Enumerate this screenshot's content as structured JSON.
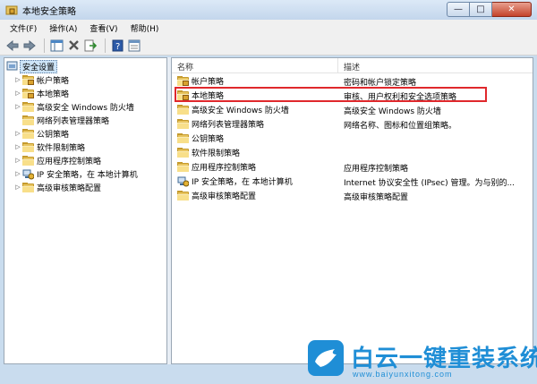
{
  "window": {
    "title": "本地安全策略",
    "controls": {
      "minimize": "—",
      "maximize": "□",
      "close": "✕"
    }
  },
  "menu": [
    "文件(F)",
    "操作(A)",
    "查看(V)",
    "帮助(H)"
  ],
  "toolbar_icons": [
    "back-icon",
    "forward-icon",
    "show-hide-tree-icon",
    "delete-icon",
    "export-list-icon",
    "help-icon",
    "properties-icon"
  ],
  "tree": {
    "root": "安全设置",
    "items": [
      {
        "label": "帐户策略",
        "icon": "lock-folder-icon"
      },
      {
        "label": "本地策略",
        "icon": "lock-folder-icon"
      },
      {
        "label": "高级安全 Windows 防火墙",
        "icon": "folder-icon"
      },
      {
        "label": "网络列表管理器策略",
        "icon": "folder-icon"
      },
      {
        "label": "公钥策略",
        "icon": "folder-icon"
      },
      {
        "label": "软件限制策略",
        "icon": "folder-icon"
      },
      {
        "label": "应用程序控制策略",
        "icon": "folder-icon"
      },
      {
        "label": "IP 安全策略，在 本地计算机",
        "icon": "ip-security-icon"
      },
      {
        "label": "高级审核策略配置",
        "icon": "folder-icon"
      }
    ]
  },
  "list": {
    "columns": {
      "name": "名称",
      "description": "描述"
    },
    "rows": [
      {
        "name": "帐户策略",
        "description": "密码和帐户锁定策略",
        "icon": "lock-folder-icon"
      },
      {
        "name": "本地策略",
        "description": "审核、用户权利和安全选项策略",
        "icon": "lock-folder-icon",
        "highlighted": true
      },
      {
        "name": "高级安全 Windows 防火墙",
        "description": "高级安全 Windows 防火墙",
        "icon": "folder-icon"
      },
      {
        "name": "网络列表管理器策略",
        "description": "网络名称、图标和位置组策略。",
        "icon": "folder-icon"
      },
      {
        "name": "公钥策略",
        "description": "",
        "icon": "folder-icon"
      },
      {
        "name": "软件限制策略",
        "description": "",
        "icon": "folder-icon"
      },
      {
        "name": "应用程序控制策略",
        "description": "应用程序控制策略",
        "icon": "folder-icon"
      },
      {
        "name": "IP 安全策略，在 本地计算机",
        "description": "Internet 协议安全性 (IPsec) 管理。为与别的...",
        "icon": "ip-security-icon"
      },
      {
        "name": "高级审核策略配置",
        "description": "高级审核策略配置",
        "icon": "folder-icon"
      }
    ]
  },
  "watermark": {
    "title": "白云一键重装系统",
    "url": "www.baiyunxitong.com"
  },
  "colors": {
    "highlight_border": "#e0282c",
    "selection": "#cde4f7",
    "watermark": "#1f8ed6"
  }
}
